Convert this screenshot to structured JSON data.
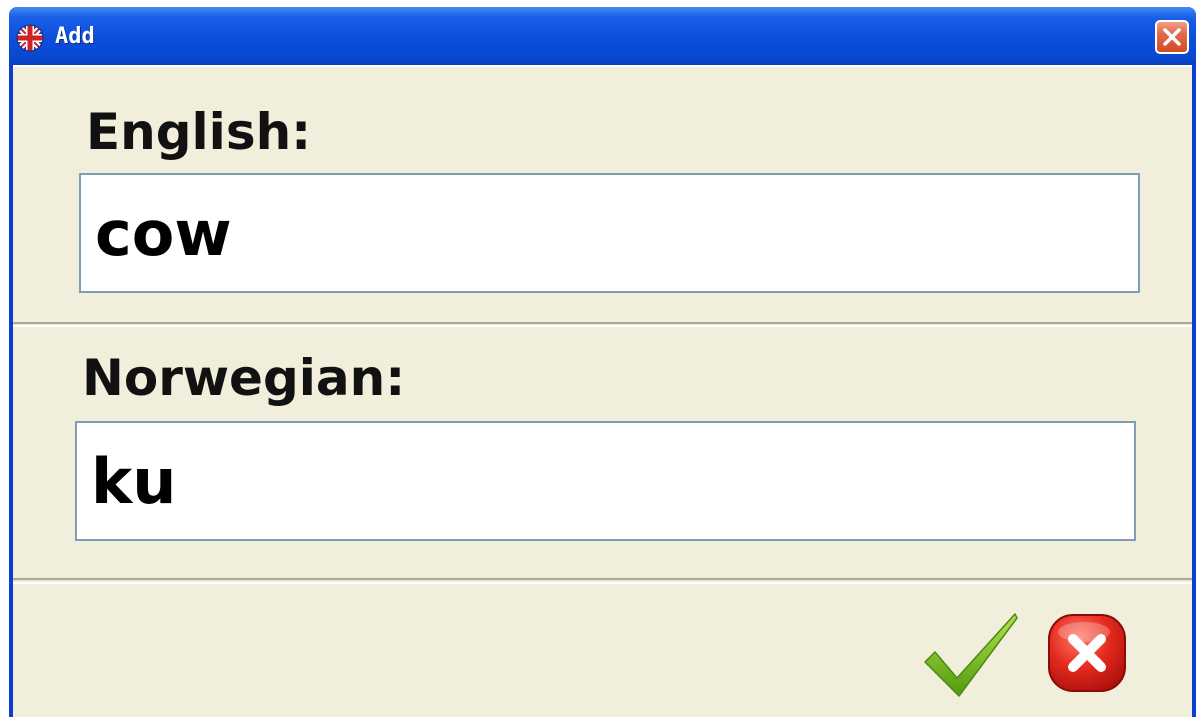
{
  "window": {
    "title": "Add",
    "title_icon": "uk-flag-icon",
    "close_icon": "close-icon"
  },
  "fields": [
    {
      "label": "English:",
      "value": "cow"
    },
    {
      "label": "Norwegian:",
      "value": "ku"
    }
  ],
  "actions": {
    "ok_icon": "checkmark-icon",
    "cancel_icon": "cancel-x-icon"
  },
  "colors": {
    "titlebar": "#0b4fdc",
    "panel": "#f1eedc",
    "input_border": "#7f9db9",
    "ok_green": "#7ac21f",
    "cancel_red": "#d81d17"
  }
}
